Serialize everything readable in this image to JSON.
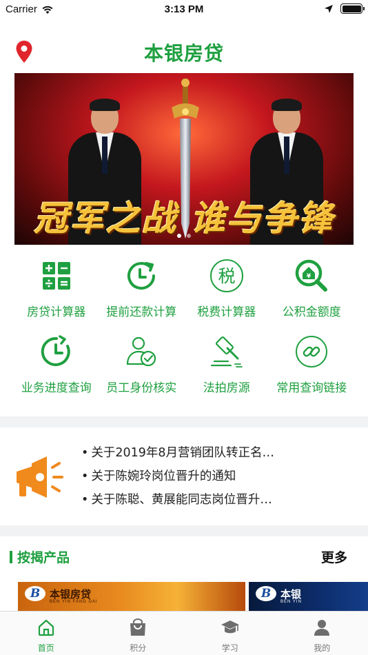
{
  "status_bar": {
    "carrier": "Carrier",
    "time": "3:13 PM"
  },
  "header": {
    "title": "本银房贷"
  },
  "banner": {
    "caption": "冠军之战 谁与争锋"
  },
  "grid": [
    {
      "label": "房贷计算器",
      "icon": "calculator-icon"
    },
    {
      "label": "提前还款计算",
      "icon": "clock-refresh-icon"
    },
    {
      "label": "税费计算器",
      "icon": "tax-icon"
    },
    {
      "label": "公积金额度",
      "icon": "house-search-icon"
    },
    {
      "label": "业务进度查询",
      "icon": "progress-clock-icon"
    },
    {
      "label": "员工身份核实",
      "icon": "user-verify-icon"
    },
    {
      "label": "法拍房源",
      "icon": "gavel-icon"
    },
    {
      "label": "常用查询链接",
      "icon": "link-icon"
    }
  ],
  "notices": [
    "关于2019年8月营销团队转正名…",
    "关于陈婉玲岗位晋升的通知",
    "关于陈聪、黄展能同志岗位晋升…"
  ],
  "products": {
    "title": "按揭产品",
    "more": "更多",
    "cards": [
      {
        "logo_letter": "B",
        "name": "本银房贷",
        "sub": "BEN YIN FANG DAI"
      },
      {
        "logo_letter": "B",
        "name": "本银",
        "sub": "BEN YIN"
      }
    ]
  },
  "tabs": [
    {
      "label": "首页",
      "icon": "home-icon",
      "active": true
    },
    {
      "label": "积分",
      "icon": "shopping-bag-icon",
      "active": false
    },
    {
      "label": "学习",
      "icon": "graduation-cap-icon",
      "active": false
    },
    {
      "label": "我的",
      "icon": "user-icon",
      "active": false
    }
  ],
  "colors": {
    "accent": "#1fa040",
    "divider": "#f1f2f4",
    "location": "#e0262c",
    "megaphone": "#f08a1d"
  }
}
